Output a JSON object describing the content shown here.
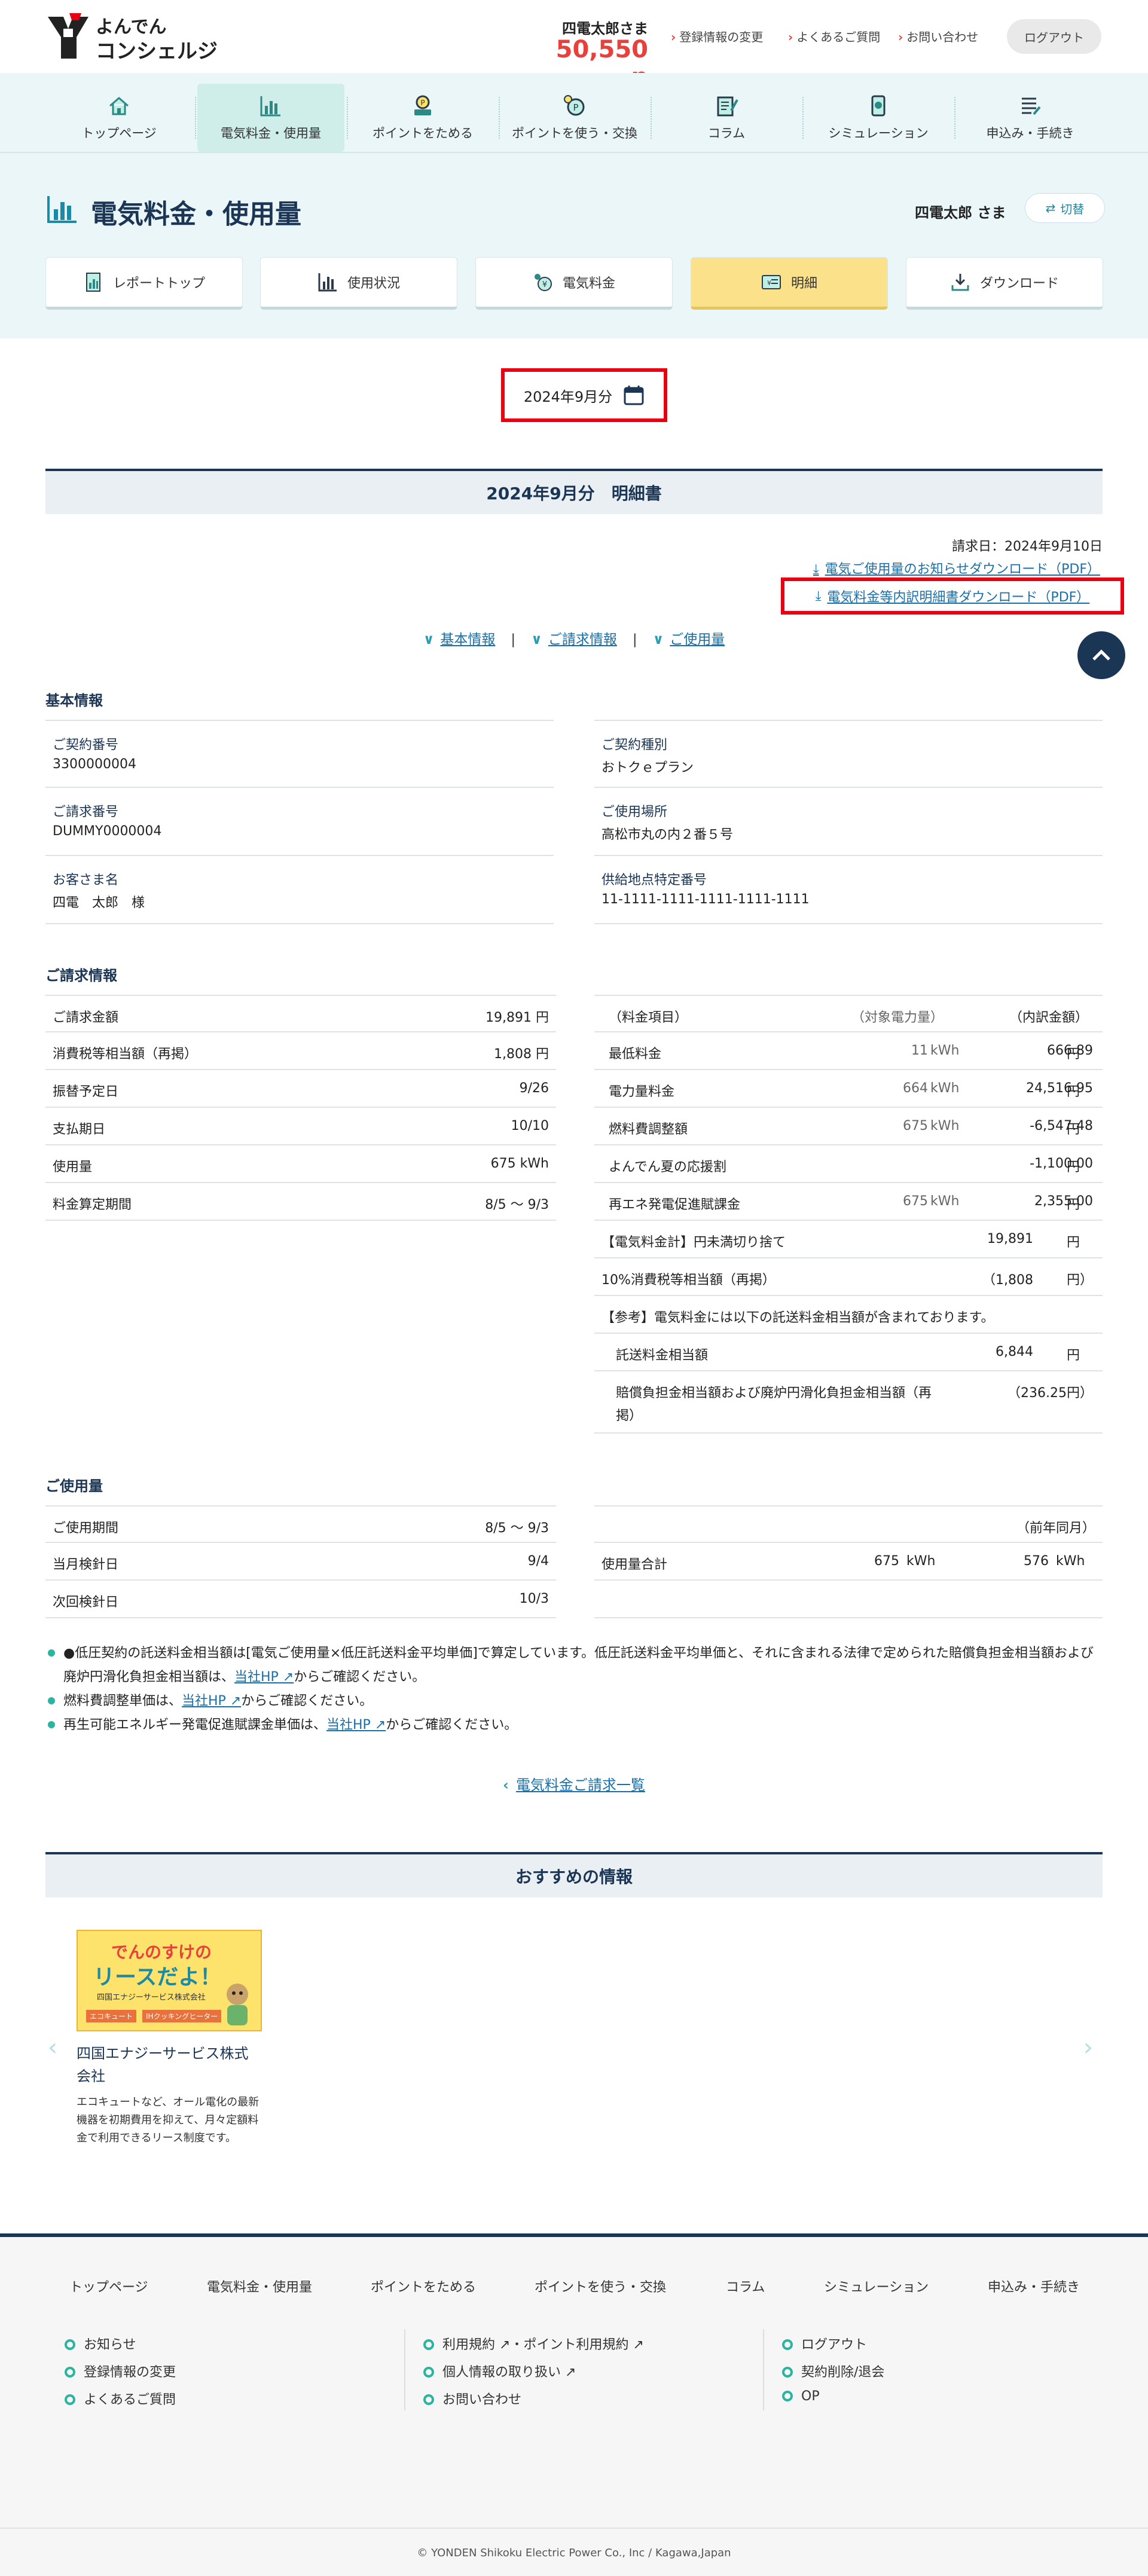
{
  "header": {
    "logo_line1": "よんでん",
    "logo_line2": "コンシェルジュ",
    "user_name": "四電太郎さま",
    "points": "50,550 p",
    "links": [
      "登録情報の変更",
      "よくあるご質問",
      "お問い合わせ"
    ],
    "logout_label": "ログアウト"
  },
  "global_nav": [
    {
      "label": "トップページ",
      "icon": "home-icon"
    },
    {
      "label": "電気料金・使用量",
      "icon": "bar-chart-icon",
      "active": true
    },
    {
      "label": "ポイントをためる",
      "icon": "point-save-icon"
    },
    {
      "label": "ポイントを使う・交換",
      "icon": "point-use-icon"
    },
    {
      "label": "コラム",
      "icon": "column-icon"
    },
    {
      "label": "シミュレーション",
      "icon": "simulation-icon"
    },
    {
      "label": "申込み・手続き",
      "icon": "application-icon"
    }
  ],
  "page": {
    "title": "電気料金・使用量",
    "user_name": "四電太郎 さま",
    "switch_label": "切替"
  },
  "sub_tabs": [
    {
      "label": "レポートトップ",
      "icon": "report-icon"
    },
    {
      "label": "使用状況",
      "icon": "usage-icon"
    },
    {
      "label": "電気料金",
      "icon": "fee-icon"
    },
    {
      "label": "明細",
      "icon": "statement-icon",
      "active": true
    },
    {
      "label": "ダウンロード",
      "icon": "download-icon"
    }
  ],
  "month_selector": "2024年9月分",
  "statement": {
    "title": "2024年9月分　明細書",
    "bill_date": "請求日：2024年9月10日",
    "download_notice": "電気ご使用量のお知らせダウンロード（PDF）",
    "download_breakdown": "電気料金等内訳明細書ダウンロード（PDF）",
    "anchors": [
      "基本情報",
      "ご請求情報",
      "ご使用量"
    ]
  },
  "basic_info": {
    "heading": "基本情報",
    "left": [
      {
        "label": "ご契約番号",
        "value": "3300000004"
      },
      {
        "label": "ご請求番号",
        "value": "DUMMY0000004"
      },
      {
        "label": "お客さま名",
        "value": "四電　太郎　様"
      }
    ],
    "right": [
      {
        "label": "ご契約種別",
        "value": "おトクｅプラン"
      },
      {
        "label": "ご使用場所",
        "value": "高松市丸の内２番５号"
      },
      {
        "label": "供給地点特定番号",
        "value": "11-1111-1111-1111-1111-1111"
      }
    ]
  },
  "billing_info": {
    "heading": "ご請求情報",
    "left": [
      {
        "label": "ご請求金額",
        "value": "19,891 円"
      },
      {
        "label": "消費税等相当額（再掲）",
        "value": "1,808 円"
      },
      {
        "label": "振替予定日",
        "value": "9/26"
      },
      {
        "label": "支払期日",
        "value": "10/10"
      },
      {
        "label": "使用量",
        "value": "675 kWh"
      },
      {
        "label": "料金算定期間",
        "value": "8/5 〜 9/3"
      }
    ],
    "right_header": {
      "item": "（料金項目）",
      "usage": "（対象電力量）",
      "amount": "（内訳金額）"
    },
    "right": [
      {
        "item": "最低料金",
        "qty": "11",
        "unit": "kWh",
        "amount": "666.89",
        "yen": "円"
      },
      {
        "item": "電力量料金",
        "qty": "664",
        "unit": "kWh",
        "amount": "24,516.95",
        "yen": "円"
      },
      {
        "item": "燃料費調整額",
        "qty": "675",
        "unit": "kWh",
        "amount": "-6,547.48",
        "yen": "円"
      },
      {
        "item": "よんでん夏の応援割",
        "qty": "",
        "unit": "",
        "amount": "-1,100.00",
        "yen": "円"
      },
      {
        "item": "再エネ発電促進賦課金",
        "qty": "675",
        "unit": "kWh",
        "amount": "2,355.00",
        "yen": "円"
      }
    ],
    "total_label": "【電気料金計】円未満切り捨て",
    "total_amount": "19,891",
    "total_yen": "円",
    "tax_label": "10%消費税等相当額（再掲）",
    "tax_amount": "（1,808",
    "tax_yen": "円）",
    "ref_note": "【参考】電気料金には以下の託送料金相当額が含まれております。",
    "consign_label": "託送料金相当額",
    "consign_amount": "6,844",
    "consign_yen": "円",
    "compensation_label": "賠償負担金相当額および廃炉円滑化負担金相当額（再掲）",
    "compensation_amount": "（236.25",
    "compensation_yen": "円）"
  },
  "usage": {
    "heading": "ご使用量",
    "left": [
      {
        "label": "ご使用期間",
        "value": "8/5 〜 9/3"
      },
      {
        "label": "当月検針日",
        "value": "9/4"
      },
      {
        "label": "次回検針日",
        "value": "10/3"
      }
    ],
    "prev_year_label": "（前年同月）",
    "total_label": "使用量合計",
    "total_current": "675",
    "total_current_unit": "kWh",
    "total_prev": "576",
    "total_prev_unit": "kWh"
  },
  "notes": [
    {
      "pre": "●低圧契約の託送料金相当額は[電気ご使用量×低圧託送料金平均単価]で算定しています。低圧託送料金平均単価と、それに含まれる法律で定められた賠償負担金相当額および廃炉円滑化負担金相当額は、",
      "link": "当社HP",
      "post": "からご確認ください。"
    },
    {
      "pre": "燃料費調整単価は、",
      "link": "当社HP",
      "post": "からご確認ください。"
    },
    {
      "pre": "再生可能エネルギー発電促進賦課金単価は、",
      "link": "当社HP",
      "post": "からご確認ください。"
    }
  ],
  "bill_list_link": "電気料金ご請求一覧",
  "recommend": {
    "heading": "おすすめの情報",
    "banner_line1": "でんのすけの",
    "banner_line2": "リースだよ！",
    "banner_company": "四国エナジーサービス株式会社",
    "banner_tag1": "エコキュート",
    "banner_tag2": "IHクッキングヒーター",
    "title": "四国エナジーサービス株式会社",
    "description": "エコキュートなど、オール電化の最新機器を初期費用を抑えて、月々定額料金で利用できるリース制度です。"
  },
  "footer": {
    "nav": [
      "トップページ",
      "電気料金・使用量",
      "ポイントをためる",
      "ポイントを使う・交換",
      "コラム",
      "シミュレーション",
      "申込み・手続き"
    ],
    "col1": [
      "お知らせ",
      "登録情報の変更",
      "よくあるご質問"
    ],
    "col2": [
      "利用規約",
      "・ポイント利用規約",
      "個人情報の取り扱い",
      "お問い合わせ"
    ],
    "col3": [
      "ログアウト",
      "契約削除/退会",
      "OP"
    ],
    "copyright": "© YONDEN Shikoku Electric Power Co., Inc / Kagawa,Japan"
  },
  "colors": {
    "accent_red": "#e60012",
    "navy": "#1b3554",
    "teal": "#2bb5a0",
    "active_tab": "#fbe28a",
    "points": "#e8413c"
  }
}
